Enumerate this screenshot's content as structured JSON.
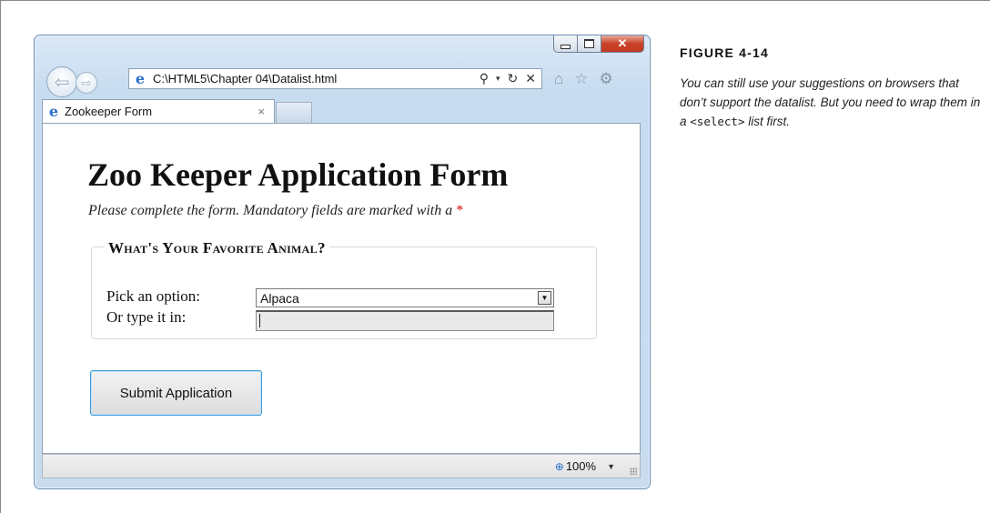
{
  "browser": {
    "address": {
      "url": "C:\\HTML5\\Chapter 04\\Datalist.html",
      "search_icon": "search-icon",
      "dropdown_icon": "chevron-down-icon",
      "refresh_icon": "refresh-icon",
      "stop_icon": "stop-icon"
    },
    "tab": {
      "title": "Zookeeper Form",
      "close_glyph": "×"
    },
    "toolbar_icons": [
      "home-icon",
      "star-icon",
      "gear-icon"
    ],
    "status": {
      "zoom": "100%"
    }
  },
  "page": {
    "title": "Zoo Keeper Application Form",
    "subtitle": "Please complete the form. Mandatory fields are marked with a",
    "required_marker": "*",
    "fieldset": {
      "legend": "What's Your Favorite Animal?",
      "pick_label": "Pick an option:",
      "pick_value": "Alpaca",
      "type_label": "Or type it in:",
      "type_value": ""
    },
    "submit_label": "Submit Application"
  },
  "figure": {
    "label": "FIGURE 4-14",
    "caption_part1": "You can still use your suggestions on browsers that don’t support the datalist. But you need to wrap them in a ",
    "caption_code": "<select>",
    "caption_part2": " list first."
  }
}
